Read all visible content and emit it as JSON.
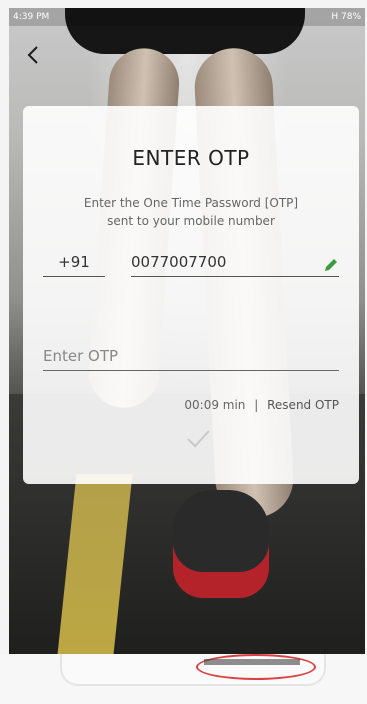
{
  "status_bar": {
    "time": "4:39 PM",
    "indicators": "H 78%"
  },
  "card": {
    "title": "ENTER OTP",
    "subtitle_line1": "Enter the One Time Password [OTP]",
    "subtitle_line2": "sent to your mobile number",
    "country_code": "+91",
    "phone_number": "0077007700",
    "otp_placeholder": "Enter OTP",
    "timer": "00:09 min",
    "separator": "|",
    "resend_label": "Resend OTP"
  },
  "colors": {
    "edit_icon": "#3a9d3a",
    "accent_red": "#d94040"
  },
  "icons": {
    "back": "chevron-left-icon",
    "edit": "pencil-icon",
    "submit": "checkmark-icon"
  }
}
